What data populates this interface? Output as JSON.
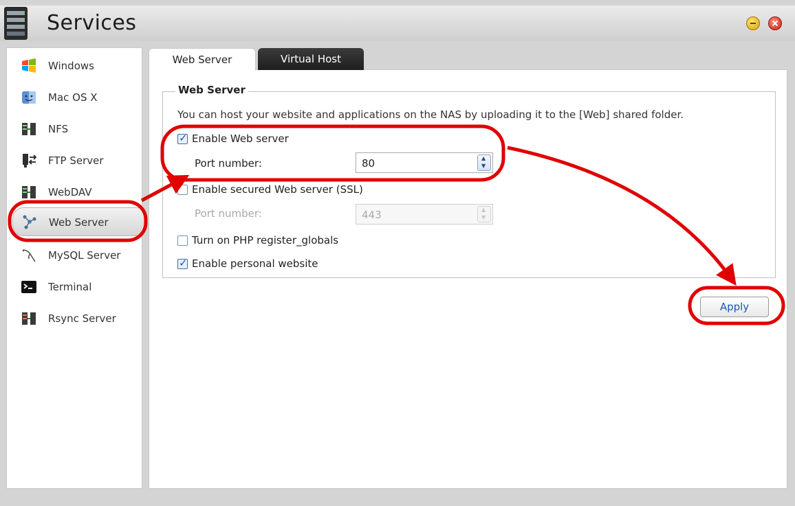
{
  "window": {
    "title": "Services"
  },
  "sidebar": {
    "items": [
      {
        "label": "Windows",
        "icon": "windows-icon"
      },
      {
        "label": "Mac OS X",
        "icon": "mac-os-icon"
      },
      {
        "label": "NFS",
        "icon": "nfs-icon"
      },
      {
        "label": "FTP Server",
        "icon": "ftp-server-icon"
      },
      {
        "label": "WebDAV",
        "icon": "webdav-icon"
      },
      {
        "label": "Web Server",
        "icon": "web-server-icon",
        "selected": true
      },
      {
        "label": "MySQL Server",
        "icon": "mysql-icon"
      },
      {
        "label": "Terminal",
        "icon": "terminal-icon"
      },
      {
        "label": "Rsync Server",
        "icon": "rsync-icon"
      }
    ]
  },
  "tabs": [
    {
      "label": "Web Server",
      "active": true
    },
    {
      "label": "Virtual Host",
      "active": false
    }
  ],
  "panel": {
    "group_title": "Web Server",
    "description": "You can host your website and applications on the NAS by uploading it to the [Web] shared folder.",
    "enable_web": {
      "label": "Enable Web server",
      "checked": true
    },
    "port": {
      "label": "Port number:",
      "value": "80"
    },
    "enable_ssl": {
      "label": "Enable secured Web server (SSL)",
      "checked": false
    },
    "ssl_port": {
      "label": "Port number:",
      "value": "443",
      "disabled": true
    },
    "php_globals": {
      "label": "Turn on PHP register_globals",
      "checked": false
    },
    "personal_site": {
      "label": "Enable personal website",
      "checked": true
    }
  },
  "apply_label": "Apply",
  "colors": {
    "annotation": "#e00000",
    "accent": "#1d56a8",
    "tab_dark": "#1e1e1e"
  }
}
